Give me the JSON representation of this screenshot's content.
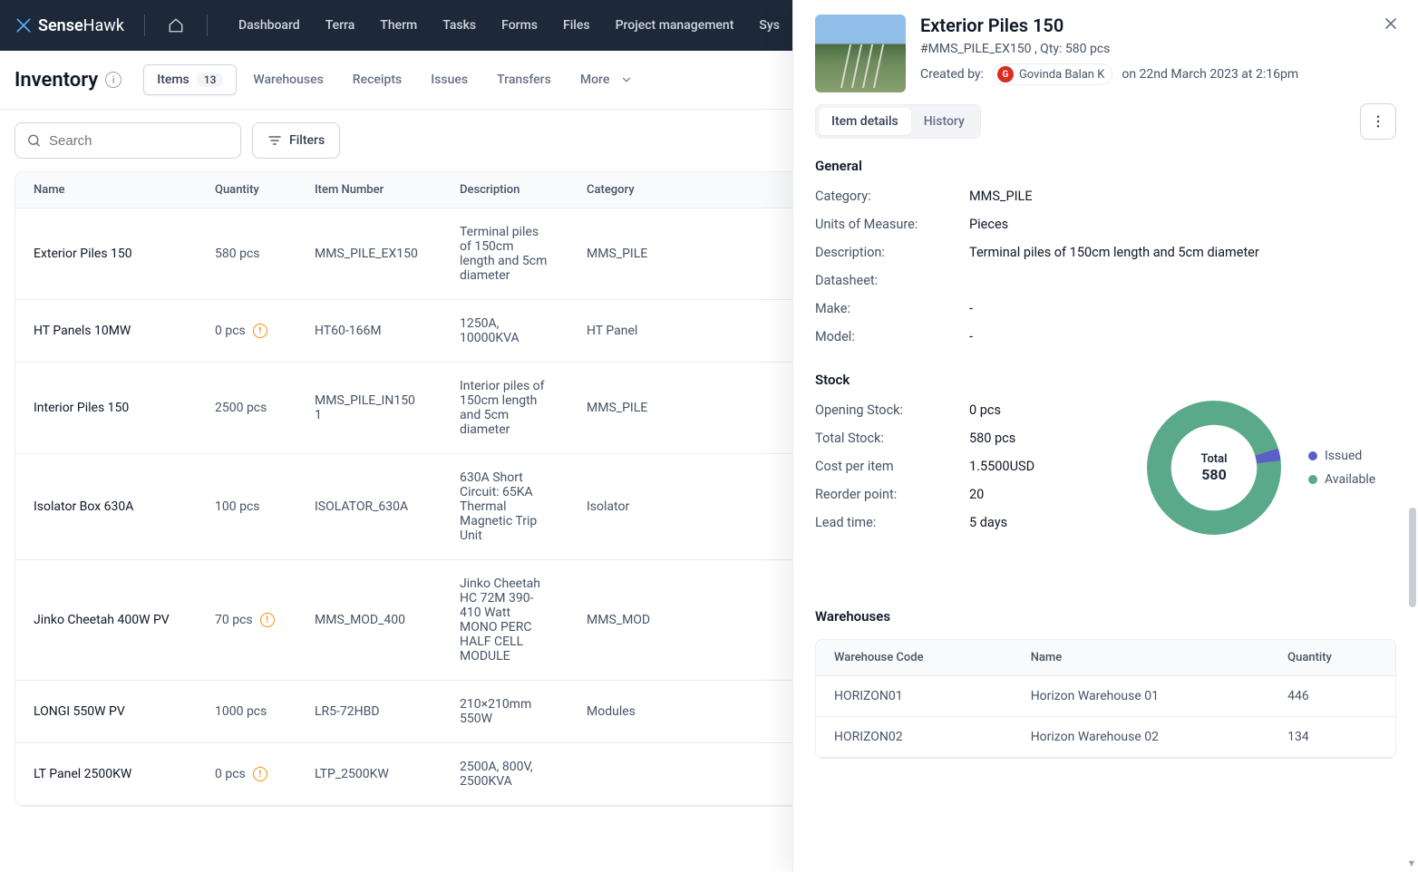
{
  "brand": {
    "name1": "Sense",
    "name2": "Hawk"
  },
  "nav": {
    "items": [
      "Dashboard",
      "Terra",
      "Therm",
      "Tasks",
      "Forms",
      "Files",
      "Project management",
      "Sys"
    ]
  },
  "page": {
    "title": "Inventory"
  },
  "tabs": {
    "items_label": "Items",
    "items_badge": "13",
    "warehouses": "Warehouses",
    "receipts": "Receipts",
    "issues": "Issues",
    "transfers": "Transfers",
    "more": "More"
  },
  "search": {
    "placeholder": "Search"
  },
  "filters_label": "Filters",
  "table": {
    "headers": {
      "name": "Name",
      "quantity": "Quantity",
      "item_number": "Item Number",
      "description": "Description",
      "category": "Category"
    },
    "rows": [
      {
        "name": "Exterior Piles 150",
        "qty": "580 pcs",
        "warn": false,
        "num": "MMS_PILE_EX150",
        "desc": "Terminal piles of 150cm length and 5cm diameter",
        "cat": "MMS_PILE"
      },
      {
        "name": "HT Panels 10MW",
        "qty": "0 pcs",
        "warn": true,
        "num": "HT60-166M",
        "desc": "1250A, 10000KVA",
        "cat": "HT Panel"
      },
      {
        "name": "Interior Piles 150",
        "qty": "2500 pcs",
        "warn": false,
        "num": "MMS_PILE_IN150 1",
        "desc": "Interior piles of 150cm length and 5cm diameter",
        "cat": "MMS_PILE"
      },
      {
        "name": "Isolator Box 630A",
        "qty": "100 pcs",
        "warn": false,
        "num": "ISOLATOR_630A",
        "desc": "630A Short Circuit: 65KA Thermal Magnetic Trip Unit",
        "cat": "Isolator"
      },
      {
        "name": "Jinko Cheetah 400W PV",
        "qty": "70 pcs",
        "warn": true,
        "num": "MMS_MOD_400",
        "desc": "Jinko Cheetah HC 72M 390-410 Watt MONO PERC HALF CELL MODULE",
        "cat": "MMS_MOD"
      },
      {
        "name": "LONGI 550W PV",
        "qty": "1000 pcs",
        "warn": false,
        "num": "LR5-72HBD",
        "desc": "210×210mm 550W",
        "cat": "Modules"
      },
      {
        "name": "LT Panel 2500KW",
        "qty": "0 pcs",
        "warn": true,
        "num": "LTP_2500KW",
        "desc": "2500A, 800V, 2500KVA",
        "cat": ""
      }
    ]
  },
  "detail": {
    "title": "Exterior Piles 150",
    "subtitle": "#MMS_PILE_EX150 , Qty: 580 pcs",
    "created_label": "Created by:",
    "creator": "Govinda Balan K",
    "creator_initial": "G",
    "created_at": "on 22nd March 2023 at 2:16pm",
    "tabs": {
      "details": "Item details",
      "history": "History"
    },
    "general": {
      "heading": "General",
      "rows": {
        "cat_k": "Category:",
        "cat_v": "MMS_PILE",
        "uom_k": "Units of Measure:",
        "uom_v": "Pieces",
        "desc_k": "Description:",
        "desc_v": "Terminal piles of 150cm length and 5cm diameter",
        "ds_k": "Datasheet:",
        "ds_v": "",
        "make_k": "Make:",
        "make_v": "-",
        "model_k": "Model:",
        "model_v": "-"
      }
    },
    "stock": {
      "heading": "Stock",
      "rows": {
        "open_k": "Opening Stock:",
        "open_v": "0 pcs",
        "total_k": "Total Stock:",
        "total_v": "580 pcs",
        "cost_k": "Cost per item",
        "cost_v": "1.5500USD",
        "reorder_k": "Reorder point:",
        "reorder_v": "20",
        "lead_k": "Lead time:",
        "lead_v": "5 days"
      },
      "donut": {
        "center_label": "Total",
        "center_value": "580"
      },
      "legend": {
        "issued": "Issued",
        "available": "Available",
        "issued_color": "#5B5FC7",
        "available_color": "#5BA98B"
      }
    },
    "warehouses": {
      "heading": "Warehouses",
      "headers": {
        "code": "Warehouse Code",
        "name": "Name",
        "qty": "Quantity"
      },
      "rows": [
        {
          "code": "HORIZON01",
          "name": "Horizon Warehouse 01",
          "qty": "446"
        },
        {
          "code": "HORIZON02",
          "name": "Horizon Warehouse 02",
          "qty": "134"
        }
      ]
    }
  },
  "chart_data": {
    "type": "pie",
    "title": "Total 580",
    "series": [
      {
        "name": "Issued",
        "value": 20,
        "color": "#5B5FC7"
      },
      {
        "name": "Available",
        "value": 560,
        "color": "#5BA98B"
      }
    ]
  }
}
